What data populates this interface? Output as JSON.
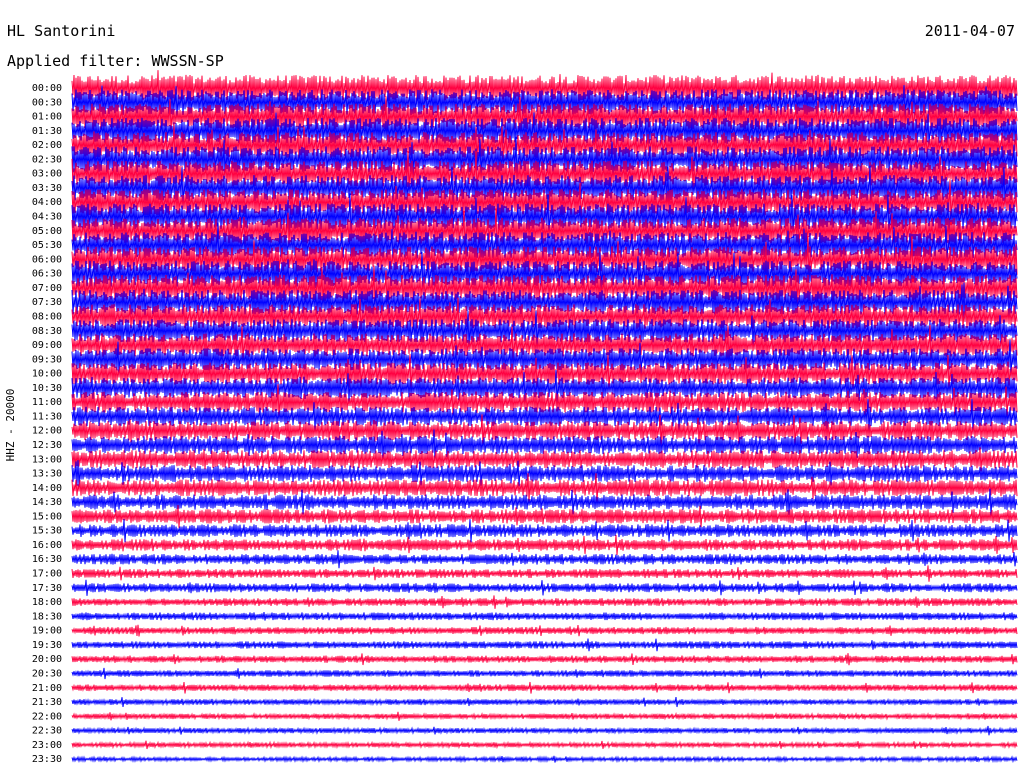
{
  "header": {
    "station": "HL Santorini",
    "date": "2011-04-07",
    "filter": "Applied filter: WWSSN-SP"
  },
  "chart_data": {
    "type": "line",
    "ylabel": "HHZ - 20000",
    "row_labels": [
      "00:00",
      "00:30",
      "01:00",
      "01:30",
      "02:00",
      "02:30",
      "03:00",
      "03:30",
      "04:00",
      "04:30",
      "05:00",
      "05:30",
      "06:00",
      "06:30",
      "07:00",
      "07:30",
      "08:00",
      "08:30",
      "09:00",
      "09:30",
      "10:00",
      "10:30",
      "11:00",
      "11:30",
      "12:00",
      "12:30",
      "13:00",
      "13:30",
      "14:00",
      "14:30",
      "15:00",
      "15:30",
      "16:00",
      "16:30",
      "17:00",
      "17:30",
      "18:00",
      "18:30",
      "19:00",
      "19:30",
      "20:00",
      "20:30",
      "21:00",
      "21:30",
      "22:00",
      "22:30",
      "23:00",
      "23:30"
    ],
    "amplitude_relative": [
      1.0,
      1.0,
      1.0,
      1.0,
      1.0,
      1.0,
      1.0,
      1.0,
      1.0,
      1.0,
      1.0,
      1.0,
      1.0,
      1.0,
      1.0,
      0.95,
      0.95,
      0.9,
      0.9,
      0.85,
      0.85,
      0.8,
      0.8,
      0.75,
      0.75,
      0.7,
      0.7,
      0.65,
      0.65,
      0.6,
      0.55,
      0.5,
      0.45,
      0.4,
      0.35,
      0.35,
      0.3,
      0.3,
      0.28,
      0.28,
      0.28,
      0.25,
      0.25,
      0.22,
      0.2,
      0.2,
      0.18,
      0.15
    ],
    "trace_colors": [
      "#ff0040",
      "#0000ff"
    ],
    "legend": "none",
    "grid": false
  }
}
